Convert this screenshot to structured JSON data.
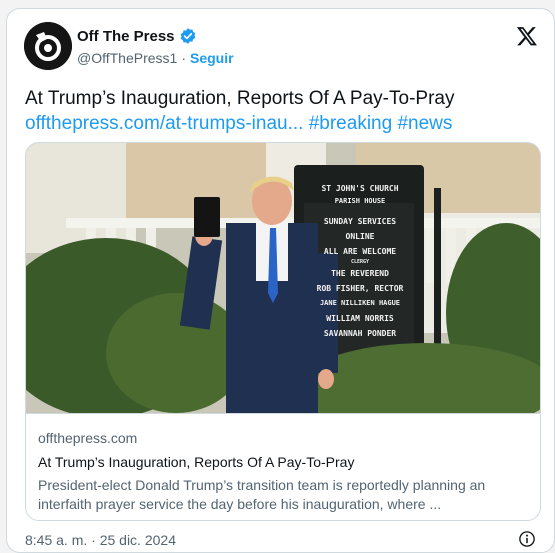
{
  "account": {
    "name": "Off The Press",
    "handle": "@OffThePress1",
    "separator": "·",
    "follow_label": "Seguir"
  },
  "tweet": {
    "text": "At Trump’s Inauguration, Reports Of A Pay-To-Pray",
    "link": "offthepress.com/at-trumps-inau...",
    "hashtags": [
      "#breaking",
      "#news"
    ]
  },
  "card": {
    "domain": "offthepress.com",
    "title": "At Trump’s Inauguration, Reports Of A Pay-To-Pray",
    "description_line1": "President-elect Donald Trump’s transition team is reportedly planning an",
    "description_line2": "interfaith prayer service the day before his inauguration, where ..."
  },
  "sign": {
    "header1": "ST JOHN'S CHURCH",
    "header2": "PARISH HOUSE",
    "lines": [
      "SUNDAY SERVICES",
      "ONLINE",
      "ALL ARE WELCOME",
      "CLERGY",
      "THE REVEREND",
      "ROB FISHER, RECTOR",
      "JANE NILLIKEN HAGUE",
      "WILLIAM NORRIS",
      "SAVANNAH PONDER"
    ]
  },
  "timestamp": "8:45 a. m. · 25 dic. 2024",
  "colors": {
    "accent": "#1d9bf0",
    "muted": "#536471",
    "border": "#cfd9de"
  },
  "icons": {
    "verified": "verified-badge-icon",
    "platform": "x-logo-icon",
    "info": "info-icon"
  }
}
